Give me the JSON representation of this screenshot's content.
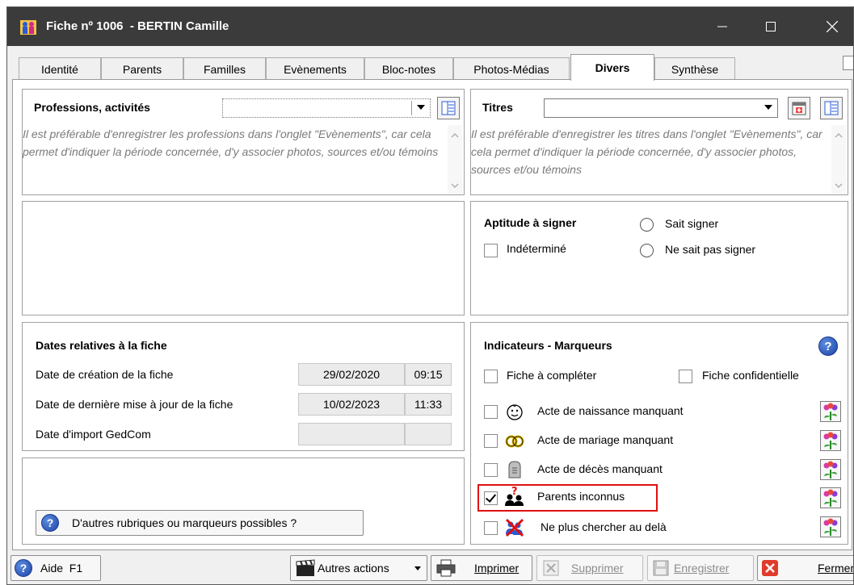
{
  "window": {
    "title": "Fiche nº 1006  - BERTIN Camille",
    "controls": {
      "minimize": "—",
      "maximize": "☐",
      "close": "✕"
    }
  },
  "tabs": [
    {
      "label": "Identité"
    },
    {
      "label": "Parents"
    },
    {
      "label": "Familles"
    },
    {
      "label": "Evènements"
    },
    {
      "label": "Bloc-notes"
    },
    {
      "label": "Photos-Médias"
    },
    {
      "label": "Divers",
      "active": true
    },
    {
      "label": "Synthèse"
    }
  ],
  "professions": {
    "label": "Professions, activités",
    "value": "",
    "hint": "Il est préférable d'enregistrer les professions dans l'onglet \"Evènements\", car cela permet d'indiquer la période concernée, d'y associer photos, sources et/ou témoins"
  },
  "titres": {
    "label": "Titres",
    "value": "",
    "hint": "Il est préférable d'enregistrer les titres dans l'onglet \"Evènements\",  car cela permet d'indiquer la période concernée, d'y associer photos, sources et/ou témoins"
  },
  "signature": {
    "label": "Aptitude à signer",
    "indetermine": "Indéterminé",
    "sait_signer": "Sait signer",
    "ne_sait_pas": "Ne sait pas signer"
  },
  "dates": {
    "label": "Dates relatives à la fiche",
    "rows": [
      {
        "label": "Date de création de la fiche",
        "date": "29/02/2020",
        "time": "09:15"
      },
      {
        "label": "Date de dernière mise à jour de la fiche",
        "date": "10/02/2023",
        "time": "11:33"
      },
      {
        "label": "Date d'import GedCom",
        "date": "",
        "time": ""
      }
    ]
  },
  "more_button": {
    "label": "D'autres rubriques ou marqueurs possibles ?"
  },
  "markers": {
    "label": "Indicateurs - Marqueurs",
    "fiche_a_completer": "Fiche à compléter",
    "fiche_confidentielle": "Fiche confidentielle",
    "items": [
      {
        "label": "Acte de naissance manquant",
        "checked": false,
        "icon": "baby-face-icon"
      },
      {
        "label": "Acte de mariage manquant",
        "checked": false,
        "icon": "rings-icon"
      },
      {
        "label": "Acte de décès manquant",
        "checked": false,
        "icon": "tombstone-icon"
      },
      {
        "label": "Parents inconnus",
        "checked": true,
        "icon": "unknown-parents-icon"
      },
      {
        "label": "Ne plus chercher au delà",
        "checked": false,
        "icon": "stop-search-icon"
      }
    ]
  },
  "footer": {
    "aide": "Aide  F1",
    "autres_actions": "Autres actions",
    "imprimer": "Imprimer",
    "supprimer": "Supprimer",
    "enregistrer": "Enregistrer",
    "fermer": "Fermer"
  },
  "colors": {
    "titlebar": "#3b3b3b",
    "highlight": "#e01010",
    "accent": "#1c43a8"
  }
}
